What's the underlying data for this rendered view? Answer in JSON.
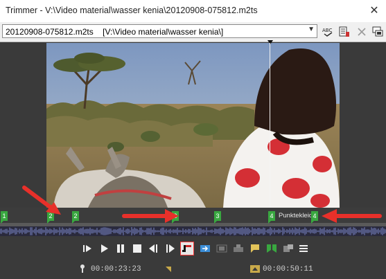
{
  "window": {
    "title": "Trimmer - V:\\Video material\\wasser kenia\\20120908-075812.m2ts",
    "close_glyph": "✕"
  },
  "toolbar": {
    "file_combo_value": "20120908-075812.m2ts    [V:\\Video material\\wasser kenia\\]",
    "icons": [
      "abc-icon",
      "properties-icon",
      "close-icon",
      "monitor-icon"
    ]
  },
  "timeline": {
    "markers": [
      {
        "label": "1"
      },
      {
        "label": "2"
      },
      {
        "label": "2"
      },
      {
        "label": "3"
      },
      {
        "label": "3"
      },
      {
        "label": "4"
      },
      {
        "label": "4"
      }
    ],
    "region_label": "Punktekleid"
  },
  "transport": {
    "buttons": [
      "play-from-start",
      "play",
      "pause",
      "stop",
      "previous-frame",
      "next-frame",
      "loop-region",
      "add-to-timeline",
      "overwrite",
      "insert",
      "marker",
      "region",
      "snapshot",
      "menu"
    ]
  },
  "timecodes": {
    "in": "00:00:23:23",
    "out": "00:00:50:11"
  },
  "colors": {
    "marker_green": "#39a840",
    "arrow_red": "#e8302a",
    "dark_bg": "#3a3a3a"
  }
}
